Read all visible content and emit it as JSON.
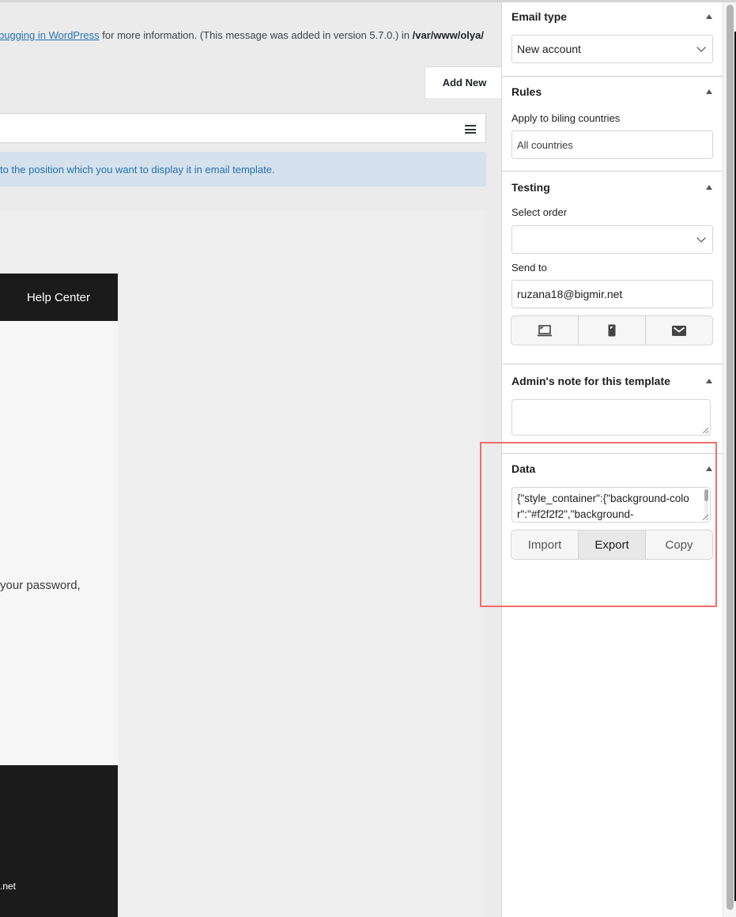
{
  "notice": {
    "link_text": "bugging in WordPress",
    "text": " for more information. (This message was added in version 5.7.0.) in ",
    "path": "/var/www/olya/"
  },
  "header": {
    "add_new_label": "Add New"
  },
  "info_banner": {
    "text": "to the position which you want to display it in email template."
  },
  "email_preview": {
    "header_link": "Help Center",
    "body_text": "your password,",
    "footer_text": ".net"
  },
  "sidebar": {
    "email_type": {
      "title": "Email type",
      "selected": "New account"
    },
    "rules": {
      "title": "Rules",
      "label": "Apply to biling countries",
      "value": "All countries"
    },
    "testing": {
      "title": "Testing",
      "select_order_label": "Select order",
      "select_order_value": "",
      "send_to_label": "Send to",
      "send_to_value": "ruzana18@bigmir.net",
      "buttons": [
        {
          "icon": "desktop-icon"
        },
        {
          "icon": "mobile-icon"
        },
        {
          "icon": "send-email-icon"
        }
      ]
    },
    "admin_note": {
      "title": "Admin's note for this template",
      "value": ""
    },
    "data": {
      "title": "Data",
      "value": "{\"style_container\":{\"background-color\":\"#f2f2f2\",\"background-",
      "buttons": [
        "Import",
        "Export",
        "Copy"
      ],
      "active_button": "Export"
    }
  },
  "colors": {
    "highlight": "#f16d6d",
    "link": "#2271b1",
    "banner_bg": "#d5e1ec",
    "email_dark": "#1b1b1b"
  }
}
